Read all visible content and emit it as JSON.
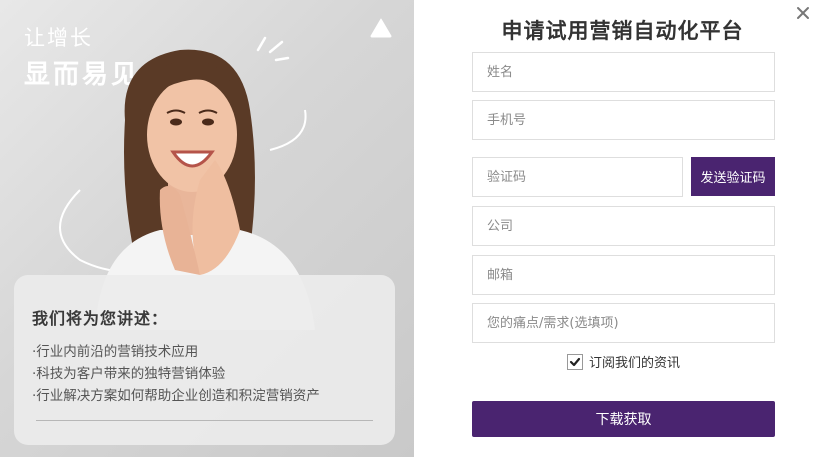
{
  "promo": {
    "headline_line1": "让增长",
    "headline_line2": "显而易见",
    "card_title": "我们将为您讲述：",
    "card_items": [
      "·行业内前沿的营销技术应用",
      "·科技为客户带来的独特营销体验",
      "·行业解决方案如何帮助企业创造和积淀营销资产"
    ]
  },
  "form": {
    "title": "申请试用营销自动化平台",
    "fields": {
      "name_placeholder": "姓名",
      "phone_placeholder": "手机号",
      "code_placeholder": "验证码",
      "company_placeholder": "公司",
      "email_placeholder": "邮箱",
      "needs_placeholder": "您的痛点/需求(选填项)"
    },
    "send_code_label": "发送验证码",
    "subscribe_label": "订阅我们的资讯",
    "subscribe_checked": true,
    "submit_label": "下载获取"
  },
  "colors": {
    "accent": "#4a2470"
  },
  "icons": {
    "close": "close-icon",
    "checkmark": "checkmark-icon",
    "logo": "logo-triangle-icon"
  }
}
